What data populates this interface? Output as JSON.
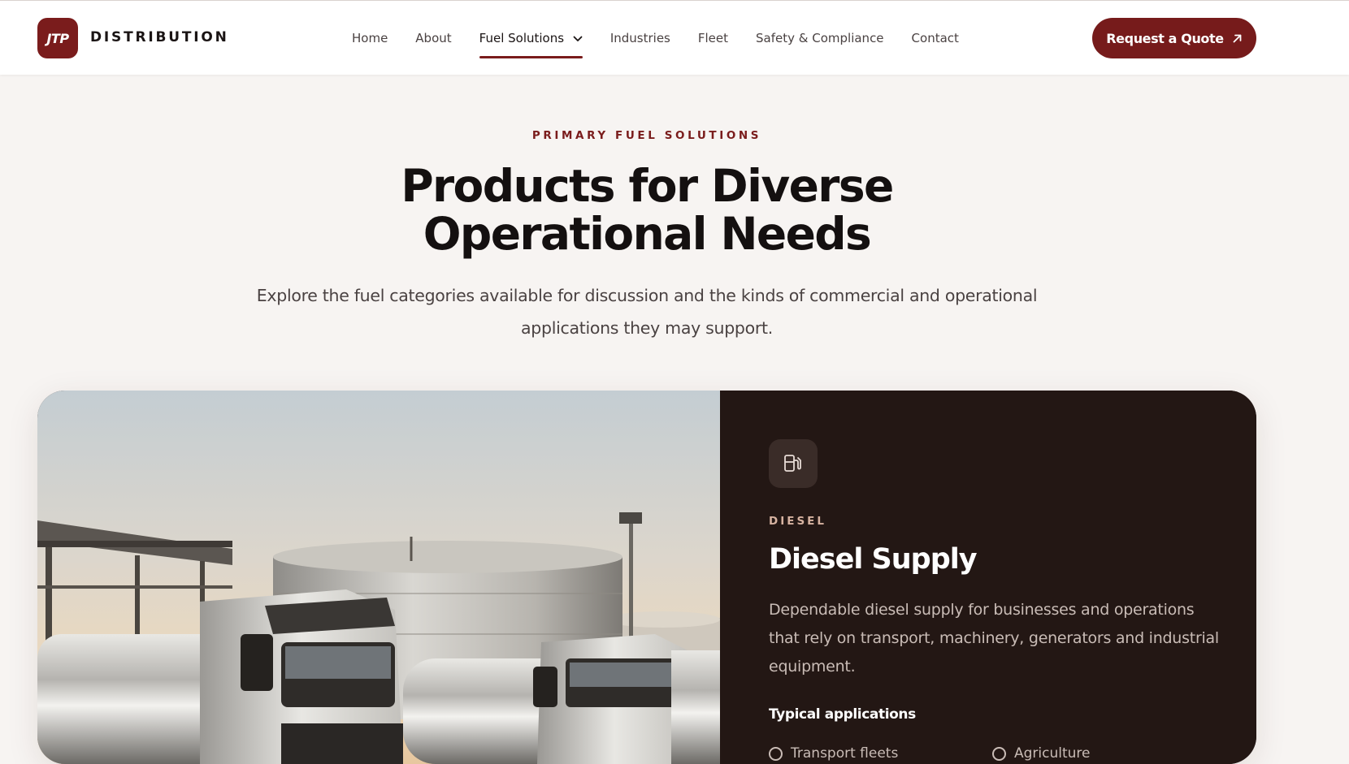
{
  "brand": {
    "logo_mark": "JTP",
    "name": "DISTRIBUTION",
    "accent": "#7a1c1c"
  },
  "nav": {
    "items": [
      {
        "label": "Home"
      },
      {
        "label": "About"
      },
      {
        "label": "Fuel Solutions",
        "active": true,
        "has_dropdown": true
      },
      {
        "label": "Industries"
      },
      {
        "label": "Fleet"
      },
      {
        "label": "Safety & Compliance"
      },
      {
        "label": "Contact"
      }
    ]
  },
  "header": {
    "cta_label": "Request a Quote",
    "cta_icon": "arrow-up-right-icon"
  },
  "intro": {
    "eyebrow": "PRIMARY FUEL SOLUTIONS",
    "title_line1": "Products for Diverse",
    "title_line2": "Operational Needs",
    "subtitle": "Explore the fuel categories available for discussion and the kinds of commercial and operational applications they may support."
  },
  "product_card": {
    "icon": "fuel-pump-icon",
    "category": "DIESEL",
    "title": "Diesel Supply",
    "description": "Dependable diesel supply for businesses and operations that rely on transport, machinery, generators and industrial equipment.",
    "applications_label": "Typical applications",
    "applications": [
      "Transport fleets",
      "Agriculture"
    ],
    "panel_color": "#231714"
  }
}
